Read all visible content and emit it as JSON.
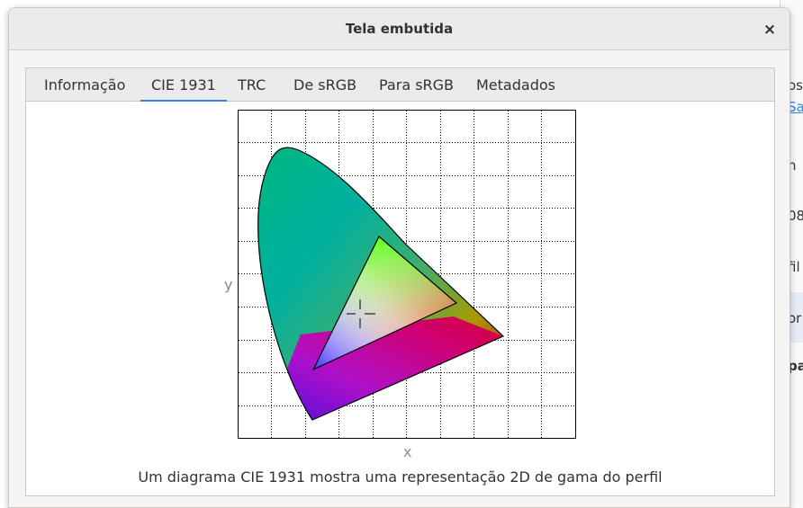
{
  "dialog": {
    "title": "Tela embutida",
    "close_label": "×"
  },
  "tabs": [
    {
      "label": "Informação",
      "active": false
    },
    {
      "label": "CIE 1931",
      "active": true
    },
    {
      "label": "TRC",
      "active": false
    },
    {
      "label": "De sRGB",
      "active": false
    },
    {
      "label": "Para sRGB",
      "active": false
    },
    {
      "label": "Metadados",
      "active": false
    }
  ],
  "plot": {
    "xlabel": "x",
    "ylabel": "y",
    "caption": "Um diagrama CIE 1931 mostra uma representação 2D de gama do perfil"
  },
  "background_window": {
    "fragments": [
      "os",
      "Sa",
      "n",
      "08",
      "fil",
      "or",
      "pa"
    ]
  },
  "colors": {
    "accent": "#3584e4",
    "titlebar": "#ebebeb",
    "dialog_bg": "#f6f5f4"
  }
}
